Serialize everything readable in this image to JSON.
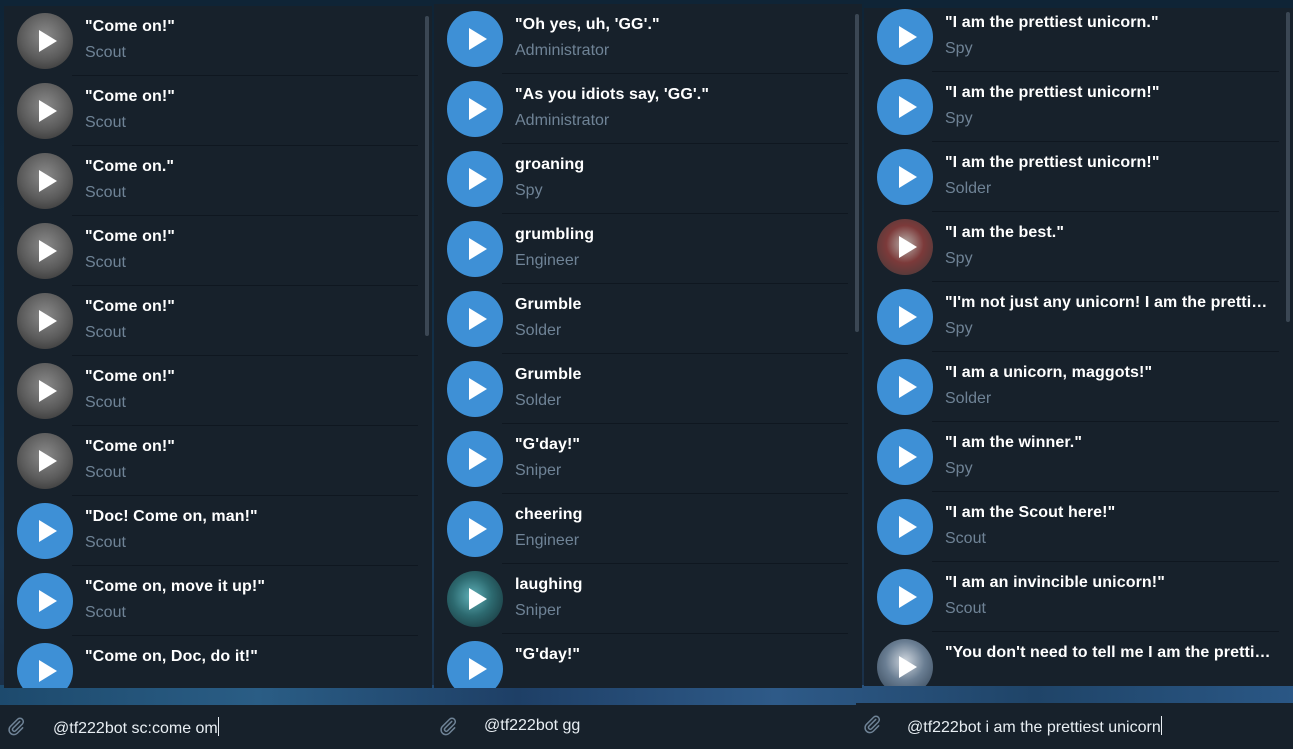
{
  "panels": [
    {
      "items": [
        {
          "title": "\"Come on!\"",
          "subtitle": "Scout",
          "avatar": "photo-a"
        },
        {
          "title": "\"Come on!\"",
          "subtitle": "Scout",
          "avatar": "photo-a"
        },
        {
          "title": "\"Come on.\"",
          "subtitle": "Scout",
          "avatar": "photo-a"
        },
        {
          "title": "\"Come on!\"",
          "subtitle": "Scout",
          "avatar": "photo-a"
        },
        {
          "title": "\"Come on!\"",
          "subtitle": "Scout",
          "avatar": "photo-a"
        },
        {
          "title": "\"Come on!\"",
          "subtitle": "Scout",
          "avatar": "photo-a"
        },
        {
          "title": "\"Come on!\"",
          "subtitle": "Scout",
          "avatar": "photo-a"
        },
        {
          "title": "\"Doc! Come on, man!\"",
          "subtitle": "Scout",
          "avatar": "blue"
        },
        {
          "title": "\"Come on, move it up!\"",
          "subtitle": "Scout",
          "avatar": "blue"
        },
        {
          "title": "\"Come on, Doc, do it!\"",
          "subtitle": "",
          "avatar": "blue"
        }
      ],
      "input_text": "@tf222bot sc:come om"
    },
    {
      "items": [
        {
          "title": "\"Oh yes, uh, 'GG'.\"",
          "subtitle": "Administrator",
          "avatar": "blue"
        },
        {
          "title": "\"As you idiots say, 'GG'.\"",
          "subtitle": "Administrator",
          "avatar": "blue"
        },
        {
          "title": "groaning",
          "subtitle": "Spy",
          "avatar": "blue"
        },
        {
          "title": "grumbling",
          "subtitle": "Engineer",
          "avatar": "blue"
        },
        {
          "title": "Grumble",
          "subtitle": "Solder",
          "avatar": "blue"
        },
        {
          "title": "Grumble",
          "subtitle": "Solder",
          "avatar": "blue"
        },
        {
          "title": "\"G'day!\"",
          "subtitle": "Sniper",
          "avatar": "blue"
        },
        {
          "title": "cheering",
          "subtitle": "Engineer",
          "avatar": "blue"
        },
        {
          "title": "laughing",
          "subtitle": "Sniper",
          "avatar": "photo-c"
        },
        {
          "title": "\"G'day!\"",
          "subtitle": "",
          "avatar": "blue"
        }
      ],
      "input_text": "@tf222bot gg"
    },
    {
      "items": [
        {
          "title": "\"I am the prettiest unicorn.\"",
          "subtitle": "Spy",
          "avatar": "blue"
        },
        {
          "title": "\"I am the prettiest unicorn!\"",
          "subtitle": "Spy",
          "avatar": "blue"
        },
        {
          "title": "\"I am the prettiest unicorn!\"",
          "subtitle": "Solder",
          "avatar": "blue"
        },
        {
          "title": "\"I am the best.\"",
          "subtitle": "Spy",
          "avatar": "photo-b"
        },
        {
          "title": "\"I'm not just any unicorn! I am the prettiest unicorn!\"",
          "subtitle": "Spy",
          "avatar": "blue"
        },
        {
          "title": "\"I am a unicorn, maggots!\"",
          "subtitle": "Solder",
          "avatar": "blue"
        },
        {
          "title": "\"I am the winner.\"",
          "subtitle": "Spy",
          "avatar": "blue"
        },
        {
          "title": "\"I am the Scout here!\"",
          "subtitle": "Scout",
          "avatar": "blue"
        },
        {
          "title": "\"I am an invincible unicorn!\"",
          "subtitle": "Scout",
          "avatar": "blue"
        },
        {
          "title": "\"You don't need to tell me I am the prettiest unicorn!\"",
          "subtitle": "",
          "avatar": "photo-d"
        }
      ],
      "input_text": "@tf222bot i am the prettiest unicorn"
    }
  ],
  "icons": {
    "play": "play-icon",
    "attach": "paperclip-icon"
  },
  "colors": {
    "panel_bg": "#17212b",
    "accent": "#3e90d6",
    "subtitle": "#6f8396"
  }
}
